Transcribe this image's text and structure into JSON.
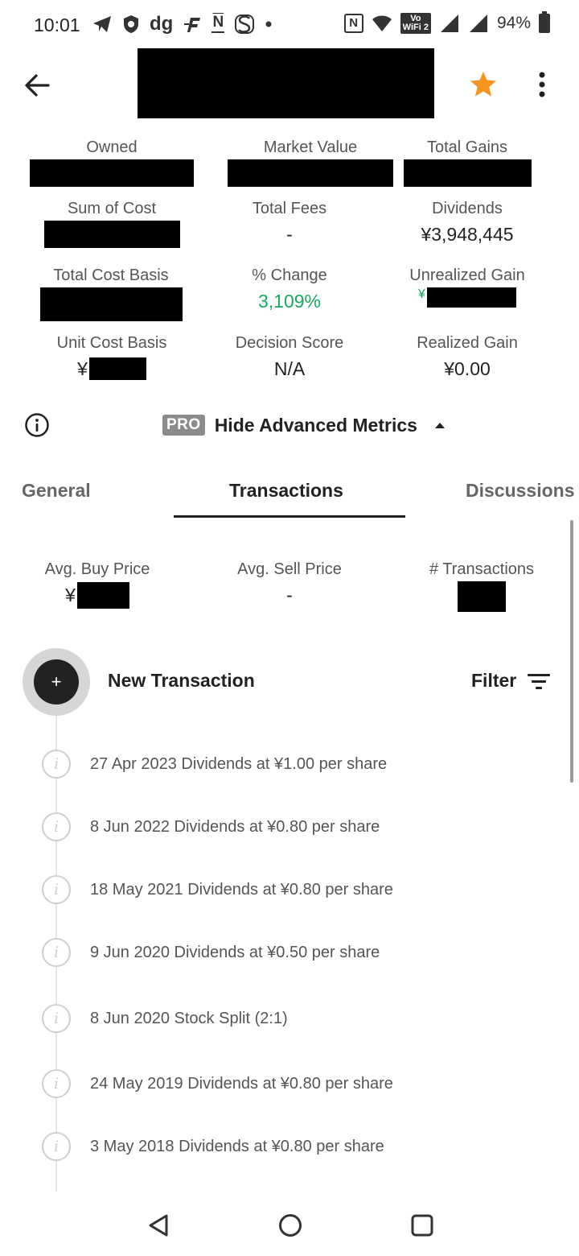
{
  "status_bar": {
    "time": "10:01",
    "left_icons": [
      "telegram-icon",
      "shield-icon",
      "dg-icon",
      "f-icon",
      "n-icon",
      "s-icon",
      "dot-icon"
    ],
    "dg_text": "dg",
    "n_text": "N",
    "vowifi_line1": "Vo",
    "vowifi_line2": "WiFi 2",
    "battery": "94%"
  },
  "metrics": {
    "owned_label": "Owned",
    "market_value_label": "Market Value",
    "total_gains_label": "Total Gains",
    "sum_of_cost_label": "Sum of Cost",
    "total_fees_label": "Total Fees",
    "total_fees_value": "-",
    "dividends_label": "Dividends",
    "dividends_value": "¥3,948,445",
    "total_cost_basis_label": "Total Cost Basis",
    "pct_change_label": "% Change",
    "pct_change_value": "3,109%",
    "unrealized_gain_label": "Unrealized Gain",
    "unrealized_gain_currency": "¥",
    "unit_cost_basis_label": "Unit Cost Basis",
    "unit_cost_basis_currency": "¥",
    "decision_score_label": "Decision Score",
    "decision_score_value": "N/A",
    "realized_gain_label": "Realized Gain",
    "realized_gain_value": "¥0.00"
  },
  "advanced": {
    "pro_badge": "PRO",
    "toggle_label": "Hide Advanced Metrics"
  },
  "tabs": [
    {
      "label": "General"
    },
    {
      "label": "Transactions"
    },
    {
      "label": "Discussions"
    }
  ],
  "summary": {
    "avg_buy_label": "Avg. Buy Price",
    "avg_buy_currency": "¥",
    "avg_sell_label": "Avg. Sell Price",
    "avg_sell_value": "-",
    "tx_count_label": "# Transactions"
  },
  "actions": {
    "new_transaction_label": "New Transaction",
    "new_transaction_icon": "+",
    "filter_label": "Filter"
  },
  "transactions": [
    "27 Apr 2023 Dividends at ¥1.00 per share",
    "8 Jun 2022 Dividends at ¥0.80 per share",
    "18 May 2021 Dividends at ¥0.80 per share",
    "9 Jun 2020 Dividends at ¥0.50 per share",
    "8 Jun 2020 Stock Split (2:1)",
    "24 May 2019 Dividends at ¥0.80 per share",
    "3 May 2018 Dividends at ¥0.80 per share"
  ],
  "colors": {
    "accent_star": "#f7941d",
    "positive": "#1aa85f",
    "text": "#222222"
  }
}
